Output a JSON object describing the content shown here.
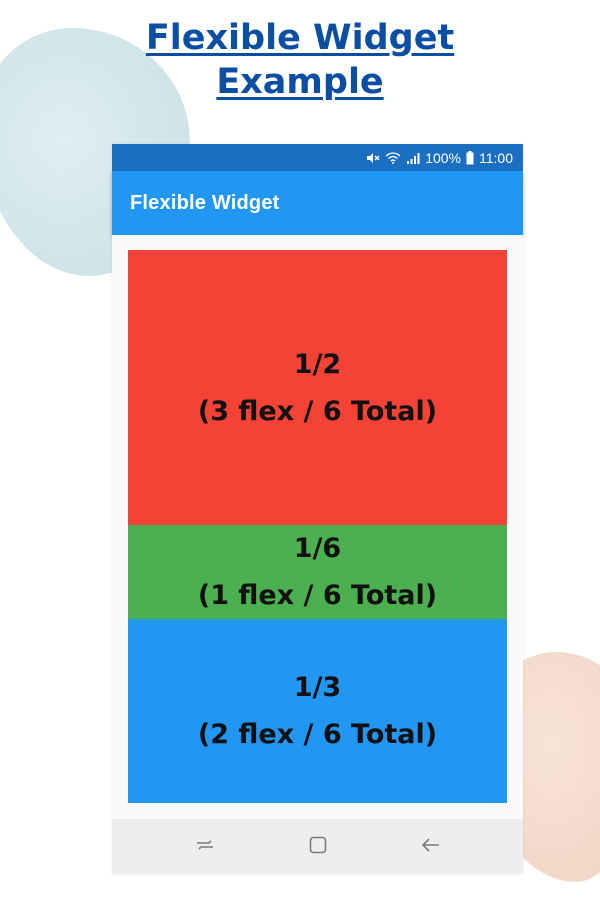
{
  "header": {
    "title_line1": "Flexible Widget ",
    "title_line2": "Example"
  },
  "status_bar": {
    "battery": "100%",
    "time": "11:00",
    "icons": [
      "mute-icon",
      "wifi-icon",
      "signal-icon",
      "battery-icon"
    ]
  },
  "app_bar": {
    "title": "Flexible Widget"
  },
  "boxes": [
    {
      "fraction": "1/2",
      "description": "(3 flex / 6 Total)",
      "flex": 3,
      "color": "#f44336"
    },
    {
      "fraction": "1/6",
      "description": "(1 flex / 6 Total)",
      "flex": 1,
      "color": "#4caf50"
    },
    {
      "fraction": "1/3",
      "description": "(2 flex / 6 Total)",
      "flex": 2,
      "color": "#2196f3"
    }
  ],
  "nav_bar": {
    "icons": [
      "recent-apps-icon",
      "home-icon",
      "back-icon"
    ]
  },
  "colors": {
    "title": "#0b4ea3",
    "status_bar": "#1a6fc2",
    "app_bar": "#2196f3"
  }
}
